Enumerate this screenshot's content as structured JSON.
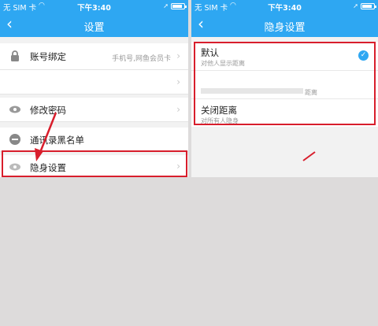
{
  "left": {
    "status": {
      "carrier": "无 SIM 卡",
      "time": "下午3:40"
    },
    "nav": {
      "back": "‹",
      "title": "设置"
    },
    "items": [
      {
        "label": "账号绑定",
        "value": "手机号,网鱼会员卡",
        "icon": "lock-icon"
      },
      {
        "label": "",
        "value": ""
      },
      {
        "label": "修改密码",
        "icon": "eye-icon"
      },
      {
        "label": "通讯录黑名单",
        "icon": "minus-circle-icon"
      },
      {
        "label": "隐身设置",
        "icon": "eye-icon"
      }
    ]
  },
  "right": {
    "status": {
      "carrier": "无 SIM 卡",
      "time": "下午3:40"
    },
    "nav": {
      "back": "‹",
      "title": "隐身设置"
    },
    "options": [
      {
        "label": "默认",
        "sub": "对他人显示距离",
        "checked": true
      },
      {
        "label": "",
        "sub": "距离",
        "checked": false
      },
      {
        "label": "关闭距离",
        "sub": "对所有人隐身",
        "checked": false
      }
    ]
  },
  "colors": {
    "accent": "#2ea7f2",
    "highlight": "#d81e2c"
  }
}
